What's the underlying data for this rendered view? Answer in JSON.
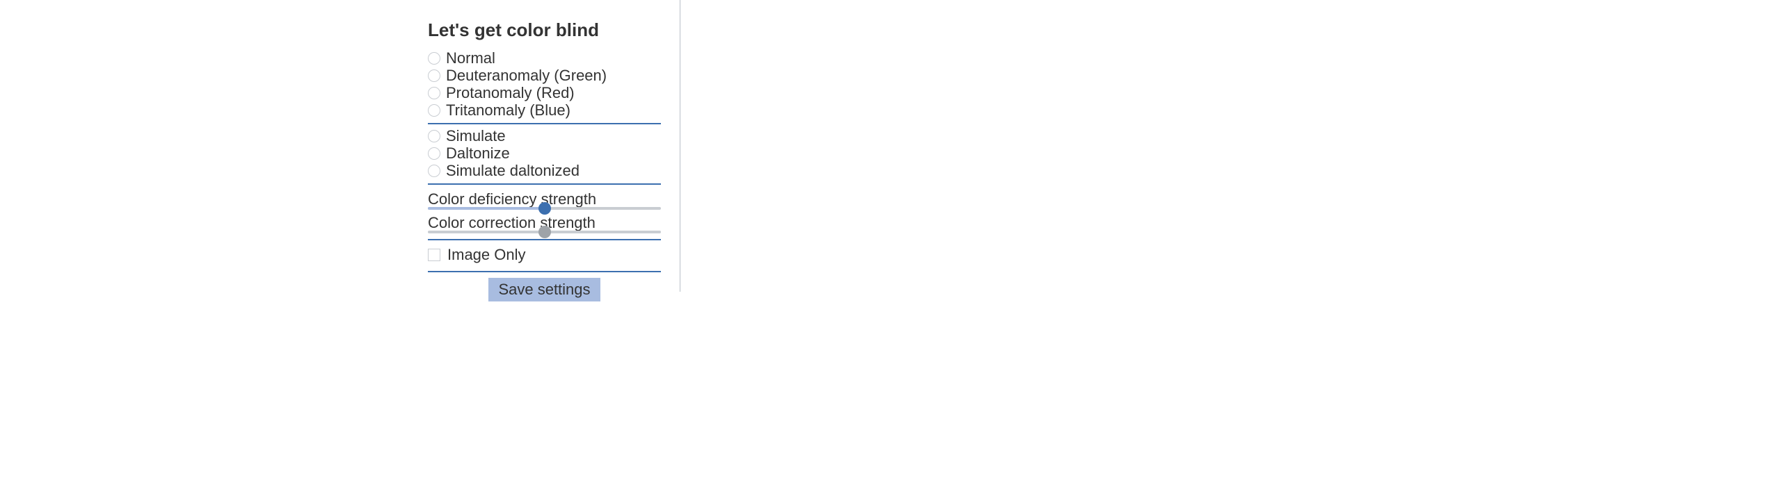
{
  "title": "Let's get color blind",
  "vision_options": [
    {
      "label": "Normal"
    },
    {
      "label": "Deuteranomaly (Green)"
    },
    {
      "label": "Protanomaly (Red)"
    },
    {
      "label": "Tritanomaly (Blue)"
    }
  ],
  "mode_options": [
    {
      "label": "Simulate"
    },
    {
      "label": "Daltonize"
    },
    {
      "label": "Simulate daltonized"
    }
  ],
  "sliders": {
    "deficiency": {
      "label": "Color deficiency strength",
      "value": 50
    },
    "correction": {
      "label": "Color correction strength",
      "value": 50
    }
  },
  "image_only": {
    "label": "Image Only",
    "checked": false
  },
  "save_label": "Save settings"
}
